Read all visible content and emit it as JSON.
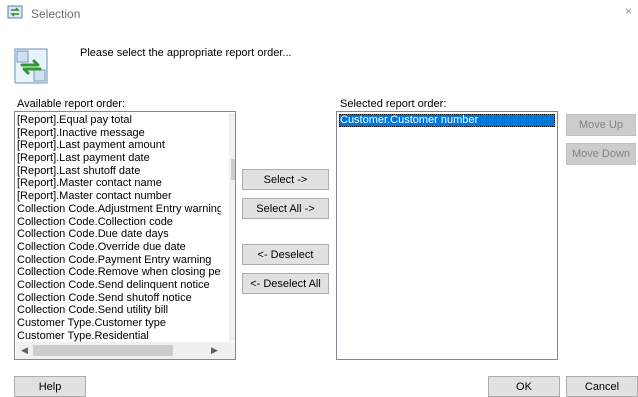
{
  "window": {
    "title": "Selection",
    "close_glyph": "×"
  },
  "header": {
    "icon": "swap-arrows-icon",
    "text": "Please select the appropriate report order..."
  },
  "available": {
    "label": "Available report order:",
    "items": [
      "[Report].Equal pay total",
      "[Report].Inactive message",
      "[Report].Last payment amount",
      "[Report].Last payment date",
      "[Report].Last shutoff date",
      "[Report].Master contact name",
      "[Report].Master contact number",
      "Collection Code.Adjustment Entry warning",
      "Collection Code.Collection code",
      "Collection Code.Due date days",
      "Collection Code.Override due date",
      "Collection Code.Payment Entry warning",
      "Collection Code.Remove when closing period",
      "Collection Code.Send delinquent notice",
      "Collection Code.Send shutoff notice",
      "Collection Code.Send utility bill",
      "Customer Type.Customer type",
      "Customer Type.Residential"
    ]
  },
  "selected": {
    "label": "Selected report order:",
    "items": [
      "Customer.Customer number"
    ]
  },
  "buttons": {
    "select": "Select ->",
    "select_all": "Select All ->",
    "deselect": "<- Deselect",
    "deselect_all": "<- Deselect All",
    "move_up": "Move Up",
    "move_down": "Move Down",
    "help": "Help",
    "ok": "OK",
    "cancel": "Cancel"
  },
  "scroll_arrows": {
    "up": "▲",
    "down": "▼",
    "left": "◀",
    "right": "▶"
  }
}
